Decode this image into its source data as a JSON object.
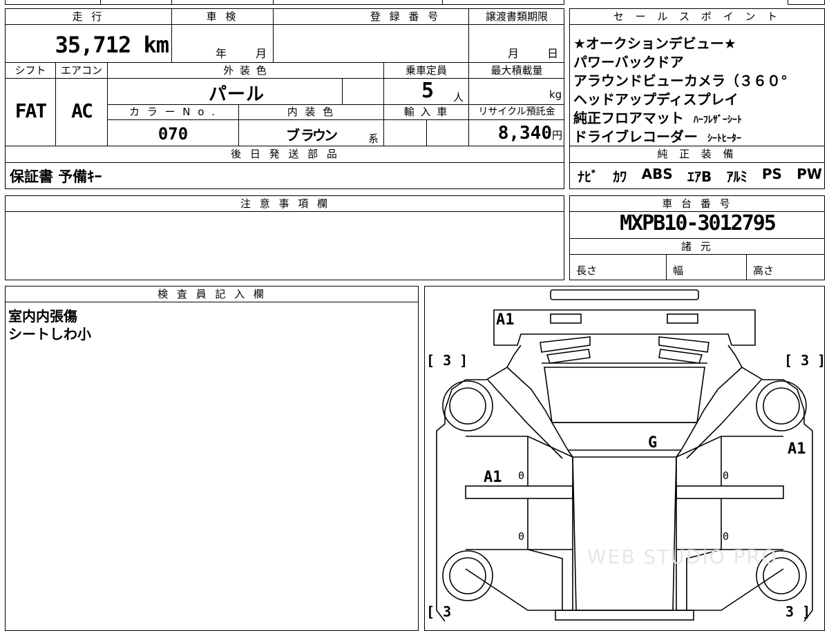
{
  "top_labels": {
    "mileage": "走 行",
    "inspection": "車 検",
    "registration": "登 録 番 号",
    "transfer_deadline": "譲渡書類期限",
    "shift": "シフト",
    "aircon": "エアコン",
    "exterior_color": "外 装 色",
    "capacity": "乗車定員",
    "max_load": "最大積載量",
    "color_no": "カ ラ ー N o .",
    "interior_color": "内 装 色",
    "import": "輸 入 車",
    "recycle": "リサイクル預託金",
    "later_parts": "後 日 発 送 部 品",
    "notes": "注 意 事 項 欄",
    "inspector": "検 査 員 記 入 欄"
  },
  "values": {
    "mileage": "35,712",
    "mileage_unit": "km",
    "inspection_year": "年",
    "inspection_month": "月",
    "transfer_month": "月",
    "transfer_day": "日",
    "shift": "FAT",
    "aircon": "AC",
    "exterior_color": "パ ー ル",
    "capacity": "5",
    "capacity_unit": "人",
    "max_load_unit": "kg",
    "color_no": "070",
    "interior_color": "ブ ラウン",
    "interior_suffix": "系",
    "recycle": "8,340",
    "recycle_unit": "円",
    "later_parts": "保証書 予備ｷｰ"
  },
  "sales_points": {
    "title": "セ ー ル ス ポ イ ン ト",
    "lines": [
      "★オークションデビュー★",
      "パワーバックドア",
      "アラウンドビューカメラ（３６０°",
      "ヘッドアップディスプレイ"
    ],
    "line5_main": "純正フロアマット",
    "line5_sub": "ﾊｰﾌﾚｻﾞｰｼｰﾄ",
    "line6_main": "ドライブレコーダー",
    "line6_sub": "ｼｰﾄﾋｰﾀｰ"
  },
  "equipment": {
    "title": "純 正 装 備",
    "items": [
      "ﾅﾋﾞ",
      "ｶﾜ",
      "ABS",
      "ｴｱB",
      "ｱﾙﾐ",
      "PS",
      "PW"
    ]
  },
  "chassis": {
    "title": "車 台 番 号",
    "number": "MXPB10-3012795",
    "spec_title": "諸 元",
    "length": "長さ",
    "width": "幅",
    "height": "高さ"
  },
  "inspector_notes": [
    "室内内張傷",
    "シートしわ小"
  ],
  "diagram": {
    "front_bumper": "A1",
    "roof": "G",
    "left_door": "A1",
    "right_side": "A1",
    "zero": "0",
    "tire_marks": [
      "[ 3 ]",
      "[ 3 ]",
      "[ 3",
      "3 ]"
    ],
    "watermark": "WEB STUDIO PRO"
  }
}
